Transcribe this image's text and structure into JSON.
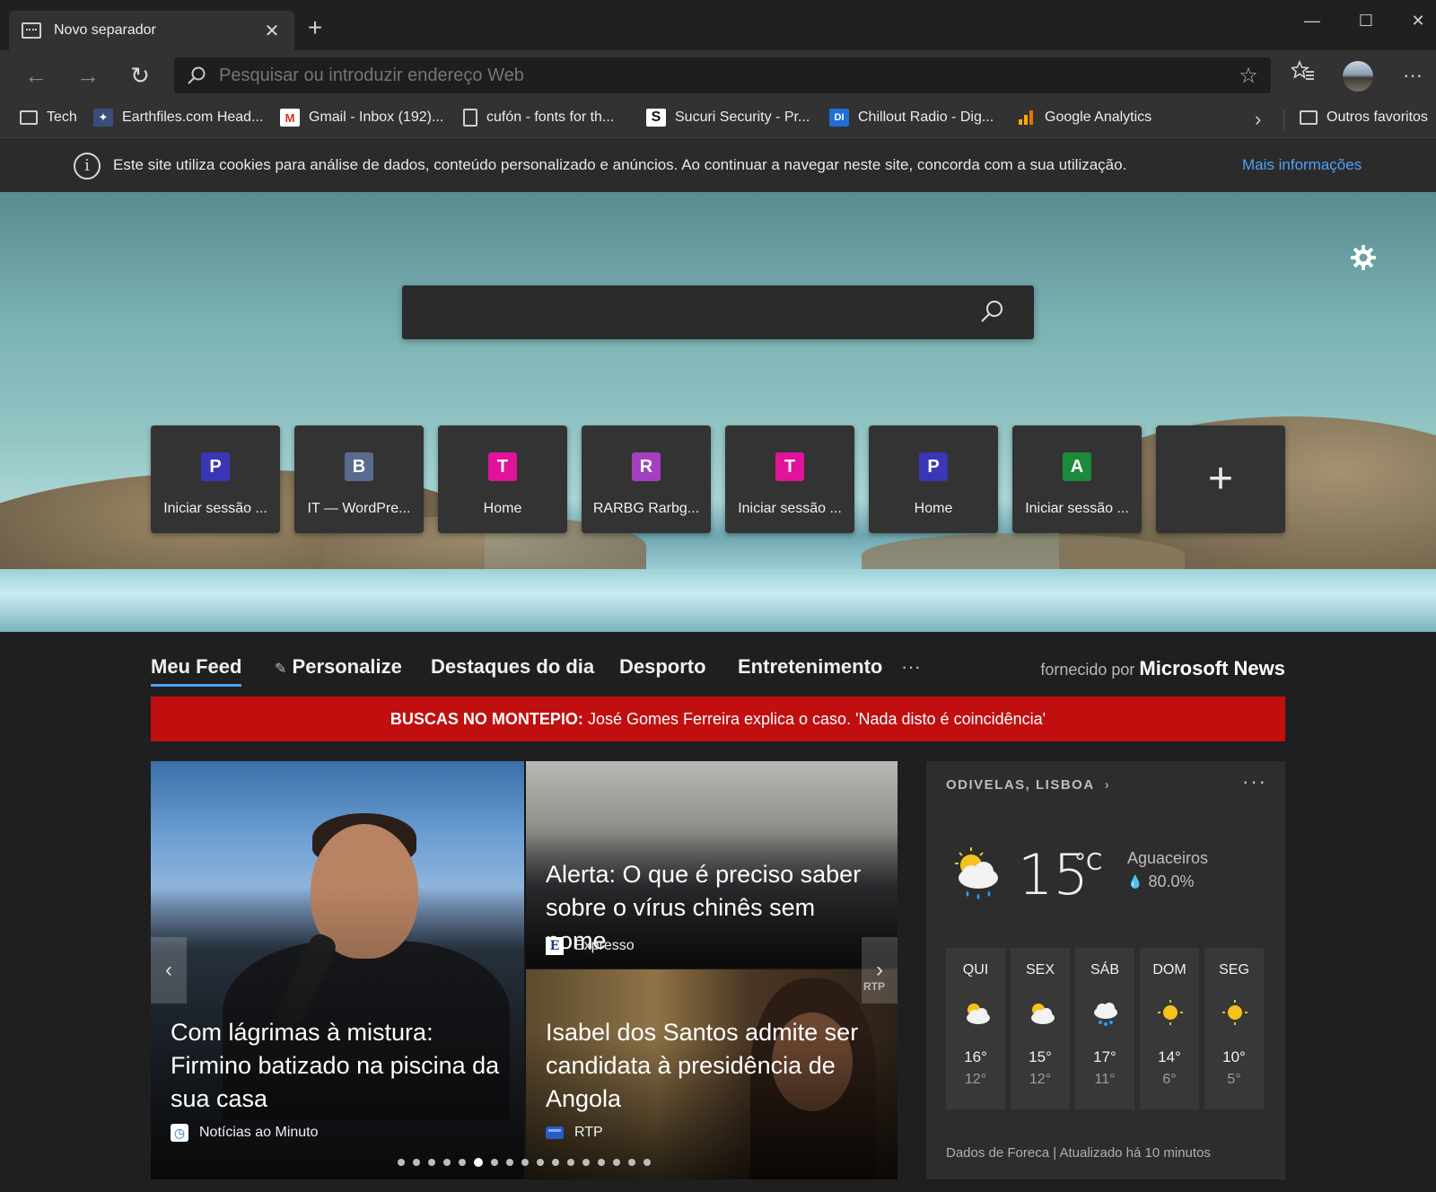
{
  "browser": {
    "tab_title": "Novo separador",
    "address_placeholder": "Pesquisar ou introduzir endereço Web"
  },
  "favorites": {
    "items": [
      {
        "label": "Tech",
        "icon": "folder-icon"
      },
      {
        "label": "Earthfiles.com Head...",
        "icon": "earthfiles-icon"
      },
      {
        "label": "Gmail - Inbox (192)...",
        "icon": "gmail-icon"
      },
      {
        "label": "cufón - fonts for th...",
        "icon": "page-icon"
      },
      {
        "label": "Sucuri Security - Pr...",
        "icon": "sucuri-icon"
      },
      {
        "label": "Chillout Radio - Dig...",
        "icon": "di-icon"
      },
      {
        "label": "Google Analytics",
        "icon": "analytics-icon"
      }
    ],
    "other_label": "Outros favoritos"
  },
  "cookie_notice": {
    "text": "Este site utiliza cookies para análise de dados, conteúdo personalizado e anúncios. Ao continuar a navegar neste site, concorda com a sua utilização.",
    "link": "Mais informações"
  },
  "quick_links": [
    {
      "letter": "P",
      "label": "Iniciar sessão ...",
      "color": "#3a36b8"
    },
    {
      "letter": "B",
      "label": "IT — WordPre...",
      "color": "#5a6a8e"
    },
    {
      "letter": "T",
      "label": "Home",
      "color": "#e0139a"
    },
    {
      "letter": "R",
      "label": "RARBG Rarbg...",
      "color": "#a43fc0"
    },
    {
      "letter": "T",
      "label": "Iniciar sessão ...",
      "color": "#e0139a"
    },
    {
      "letter": "P",
      "label": "Home",
      "color": "#3a36b8"
    },
    {
      "letter": "A",
      "label": "Iniciar sessão ...",
      "color": "#1c8a3c"
    }
  ],
  "feed": {
    "tabs": [
      "Meu Feed",
      "Personalize",
      "Destaques do dia",
      "Desporto",
      "Entretenimento"
    ],
    "more": "···",
    "provided_prefix": "fornecido por",
    "provider": "Microsoft News"
  },
  "breaking": {
    "label": "BUSCAS NO MONTEPIO:",
    "text": "José Gomes Ferreira explica o caso. 'Nada disto é coincidência'"
  },
  "news": [
    {
      "headline": "Com lágrimas à mistura: Firmino batizado na piscina da sua casa",
      "source": "Notícias ao Minuto"
    },
    {
      "headline": "Alerta: O que é preciso saber sobre o vírus chinês sem nome",
      "source": "Expresso"
    },
    {
      "headline": "Isabel dos Santos admite ser candidata à presidência de Angola",
      "source": "RTP"
    }
  ],
  "news_watermark": "RTP",
  "carousel": {
    "prev": "‹",
    "next": "›",
    "dots_total": 17,
    "active_dot": 5
  },
  "weather": {
    "location": "ODIVELAS, LISBOA",
    "more": "···",
    "temp": "15",
    "unit": "°C",
    "condition": "Aguaceiros",
    "precip": "80.0%",
    "days": [
      {
        "name": "QUI",
        "hi": "16°",
        "lo": "12°",
        "icon": "partly-cloudy-icon"
      },
      {
        "name": "SEX",
        "hi": "15°",
        "lo": "12°",
        "icon": "partly-cloudy-icon"
      },
      {
        "name": "SÁB",
        "hi": "17°",
        "lo": "11°",
        "icon": "rain-icon"
      },
      {
        "name": "DOM",
        "hi": "14°",
        "lo": "6°",
        "icon": "sunny-icon"
      },
      {
        "name": "SEG",
        "hi": "10°",
        "lo": "5°",
        "icon": "sunny-icon"
      }
    ],
    "footer": "Dados de Foreca | Atualizado há 10 minutos"
  }
}
